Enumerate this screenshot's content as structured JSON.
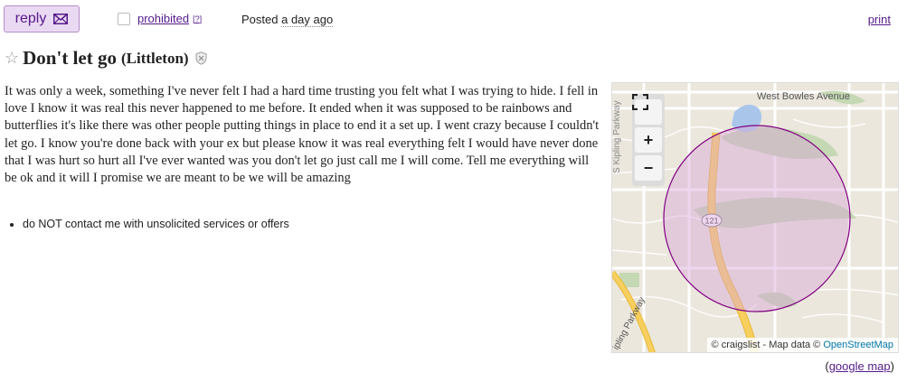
{
  "header": {
    "reply_label": "reply",
    "prohibited_label": "prohibited",
    "prohibited_help": "[?]",
    "posted_prefix": "Posted",
    "posted_time": "a day ago",
    "print_label": "print"
  },
  "post": {
    "title": "Don't let go",
    "location": "(Littleton)",
    "body": "It was only a week, something I've never felt I had a hard time trusting you felt what I was trying to hide. I fell in love I know it was real this never happened to me before. It ended when it was supposed to be rainbows and butterflies it's like there was other people putting things in place to end it a set up. I went crazy because I couldn't let go. I know you're done back with your ex but please know it was real everything felt I would have never done that I was hurt so hurt all I've ever wanted was you don't let go just call me I will come. Tell me everything will be ok and it will I promise we are meant to be we will be amazing",
    "notices": [
      "do NOT contact me with unsolicited services or offers"
    ]
  },
  "map": {
    "street_top": "West Bowles Avenue",
    "street_left": "S Kipling Parkway",
    "street_bottom": "ipling Parkway",
    "route_label": "121",
    "zoom_in": "+",
    "zoom_out": "−",
    "attribution_text": "© craigslist - Map data ©",
    "attribution_link": "OpenStreetMap",
    "google_prefix": "(",
    "google_link": "google map",
    "google_suffix": ")",
    "colors": {
      "circle_fill": "#d9a6d9",
      "circle_stroke": "#800080",
      "highway": "#f7cf5e"
    }
  }
}
